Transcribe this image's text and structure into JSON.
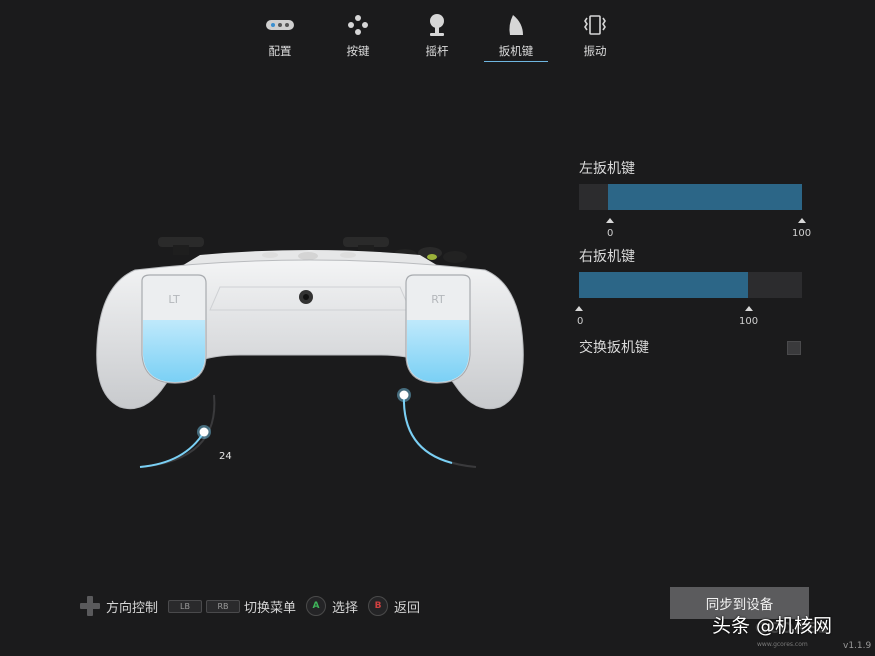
{
  "tabs": [
    {
      "label": "配置",
      "icon": "config-dots-icon",
      "active": false
    },
    {
      "label": "按键",
      "icon": "buttons-icon",
      "active": false
    },
    {
      "label": "摇杆",
      "icon": "joystick-icon",
      "active": false
    },
    {
      "label": "扳机键",
      "icon": "trigger-icon",
      "active": true
    },
    {
      "label": "振动",
      "icon": "vibration-icon",
      "active": false
    }
  ],
  "controller": {
    "left_trigger_value": "24",
    "accent_color": "#7ad0f5"
  },
  "panel": {
    "left_trigger": {
      "title": "左扳机键",
      "range": {
        "min": "0",
        "max": "100"
      },
      "fill_start_fraction": 0.13,
      "fill_end_fraction": 1.0
    },
    "right_trigger": {
      "title": "右扳机键",
      "range": {
        "min": "0",
        "max": "100"
      },
      "fill_start_fraction": 0.0,
      "fill_end_fraction": 0.76
    },
    "swap": {
      "label": "交换扳机键",
      "checked": false
    }
  },
  "hints": {
    "dpad_label": "方向控制",
    "lb": "LB",
    "rb": "RB",
    "switch_menu_label": "切换菜单",
    "a_button": "A",
    "select_label": "选择",
    "b_button": "B",
    "back_label": "返回"
  },
  "sync_button": "同步到设备",
  "watermark": "头条 @机核网",
  "logo_url": "www.gcores.com",
  "version": "v1.1.9",
  "colors": {
    "background": "#1b1b1c",
    "bar_fill": "#2c6687",
    "tab_underline": "#6fb6e0",
    "a_button": "#3fb55a",
    "b_button": "#d04040"
  }
}
